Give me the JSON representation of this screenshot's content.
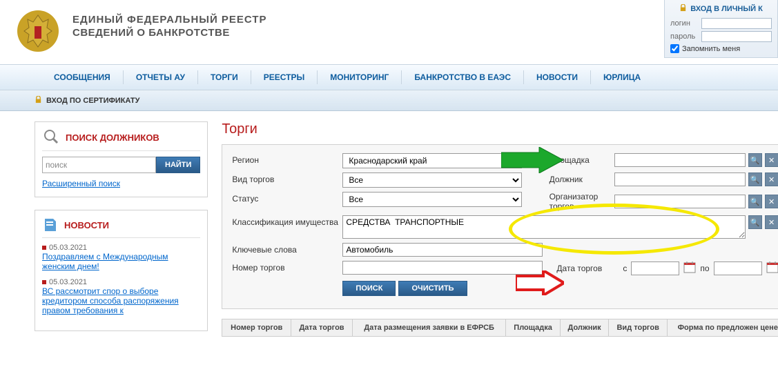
{
  "header": {
    "title_line1": "ЕДИНЫЙ  ФЕДЕРАЛЬНЫЙ  РЕЕСТР",
    "title_line2": "СВЕДЕНИЙ О БАНКРОТСТВЕ"
  },
  "login": {
    "header": "ВХОД В ЛИЧНЫЙ К",
    "login_label": "логин",
    "password_label": "пароль",
    "remember_label": "Запомнить меня"
  },
  "nav": {
    "items": [
      "СООБЩЕНИЯ",
      "ОТЧЕТЫ АУ",
      "ТОРГИ",
      "РЕЕСТРЫ",
      "МОНИТОРИНГ",
      "БАНКРОТСТВО В ЕАЭС",
      "НОВОСТИ",
      "ЮРЛИЦА"
    ]
  },
  "cert_login": "ВХОД ПО СЕРТИФИКАТУ",
  "sidebar": {
    "search": {
      "title": "ПОИСК ДОЛЖНИКОВ",
      "placeholder": "поиск",
      "button": "НАЙТИ",
      "advanced": "Расширенный поиск"
    },
    "news": {
      "title": "НОВОСТИ",
      "items": [
        {
          "date": "05.03.2021",
          "text": "Поздравляем с Международным женским днем!"
        },
        {
          "date": "05.03.2021",
          "text": "ВС рассмотрит спор о выборе кредитором способа распоряжения правом требования к"
        }
      ]
    }
  },
  "page": {
    "title": "Торги",
    "filters": {
      "region_label": "Регион",
      "region_value": "Краснодарский край",
      "type_label": "Вид торгов",
      "type_value": "Все",
      "status_label": "Статус",
      "status_value": "Все",
      "classification_label": "Классификация имущества",
      "classification_value": "СРЕДСТВА  ТРАНСПОРТНЫЕ",
      "keywords_label": "Ключевые слова",
      "keywords_value": "Автомобиль",
      "number_label": "Номер торгов",
      "platform_label": "Площадка",
      "debtor_label": "Должник",
      "organizer_label": "Организатор торгов",
      "date_label": "Дата торгов",
      "date_from": "с",
      "date_to": "по",
      "search_btn": "ПОИСК",
      "clear_btn": "ОЧИСТИТЬ"
    },
    "table_headers": [
      "Номер торгов",
      "Дата торгов",
      "Дата размещения заявки в ЕФРСБ",
      "Площадка",
      "Должник",
      "Вид торгов",
      "Форма по предложен цене"
    ]
  }
}
